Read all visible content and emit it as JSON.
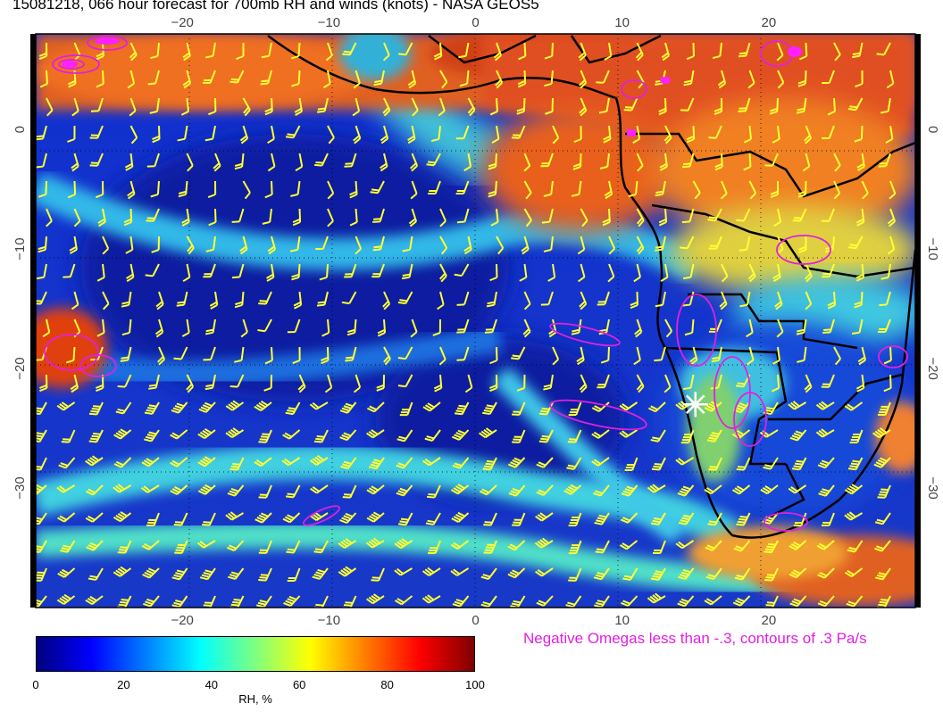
{
  "title": "15081218, 066 hour forecast for 700mb RH and winds (knots) - NASA GEOS5",
  "map": {
    "lon_range": [
      -30,
      30
    ],
    "lat_range": [
      -40,
      8
    ],
    "lon_ticks": [
      -20,
      -10,
      0,
      10,
      20
    ],
    "lat_ticks": [
      0,
      -10,
      -20,
      -30
    ],
    "lon_tick_labels": [
      "−20",
      "−10",
      "0",
      "10",
      "20"
    ],
    "lat_tick_labels": [
      "0",
      "−10",
      "−20",
      "−30"
    ],
    "marker": {
      "lon": 15,
      "lat": -23,
      "symbol": "asterisk"
    },
    "overlay_note": "Negative Omegas less than -.3, contours of .3 Pa/s",
    "colors": {
      "barbs": "#ffff33",
      "omega": "#e020e0",
      "coast": "#000000",
      "marker": "#ffffff"
    }
  },
  "colorbar": {
    "title": "RH, %",
    "min": 0,
    "max": 100,
    "tick_labels": [
      "0",
      "20",
      "40",
      "60",
      "80",
      "100"
    ],
    "stops": [
      "#00007f",
      "#0000ff",
      "#007fff",
      "#00ffff",
      "#7fff7f",
      "#ffff00",
      "#ff7f00",
      "#ff0000",
      "#7f0000"
    ]
  }
}
